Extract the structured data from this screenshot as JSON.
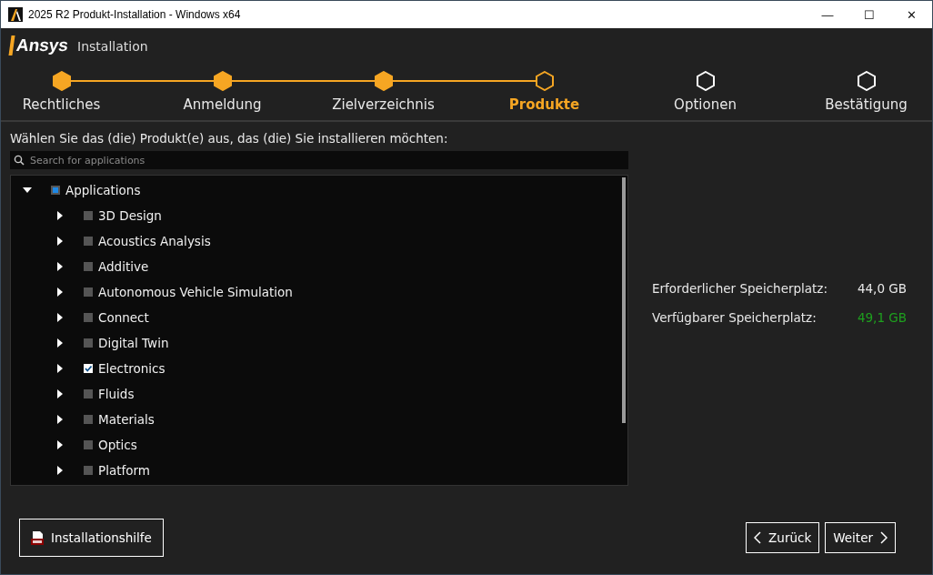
{
  "window": {
    "title": "2025 R2 Produkt-Installation - Windows x64",
    "controls": [
      "—",
      "☐",
      "✕"
    ]
  },
  "header": {
    "logo": "Ansys",
    "subtitle": "Installation"
  },
  "steps": [
    {
      "label": "Rechtliches",
      "completed": true,
      "selected": false
    },
    {
      "label": "Anmeldung",
      "completed": true,
      "selected": false
    },
    {
      "label": "Zielverzeichnis",
      "completed": true,
      "selected": false
    },
    {
      "label": "Produkte",
      "completed": false,
      "selected": true
    },
    {
      "label": "Optionen",
      "completed": false,
      "selected": false
    },
    {
      "label": "Bestätigung",
      "completed": false,
      "selected": false
    }
  ],
  "instruction": "Wählen Sie das (die) Produkt(e) aus, das (die) Sie installieren möchten:",
  "search": {
    "placeholder": "Search for applications"
  },
  "tree": [
    {
      "label": "Applications",
      "expanded": true,
      "checked": false,
      "partial": true,
      "children": [
        {
          "label": "3D Design",
          "expanded": false,
          "checked": false,
          "partial": false
        },
        {
          "label": "Acoustics Analysis",
          "expanded": false,
          "checked": false,
          "partial": false
        },
        {
          "label": "Additive",
          "expanded": false,
          "checked": false,
          "partial": false
        },
        {
          "label": "Autonomous Vehicle Simulation",
          "expanded": false,
          "checked": false,
          "partial": false
        },
        {
          "label": "Connect",
          "expanded": false,
          "checked": false,
          "partial": false
        },
        {
          "label": "Digital Twin",
          "expanded": false,
          "checked": false,
          "partial": false
        },
        {
          "label": "Electronics",
          "expanded": false,
          "checked": true,
          "partial": false
        },
        {
          "label": "Fluids",
          "expanded": false,
          "checked": false,
          "partial": false
        },
        {
          "label": "Materials",
          "expanded": false,
          "checked": false,
          "partial": false
        },
        {
          "label": "Optics",
          "expanded": false,
          "checked": false,
          "partial": false
        },
        {
          "label": "Platform",
          "expanded": false,
          "checked": false,
          "partial": false
        }
      ]
    }
  ],
  "storage": [
    {
      "label": "Erforderlicher Speicherplatz:",
      "value": "44,0 GB",
      "color": "#e8e8e8"
    },
    {
      "label": "Verfügbarer Speicherplatz:",
      "value": "49,1 GB",
      "color": "#1ea01e"
    }
  ],
  "help_button": "Installationshilfe",
  "back_button": "Zurück",
  "next_button": "Weiter"
}
